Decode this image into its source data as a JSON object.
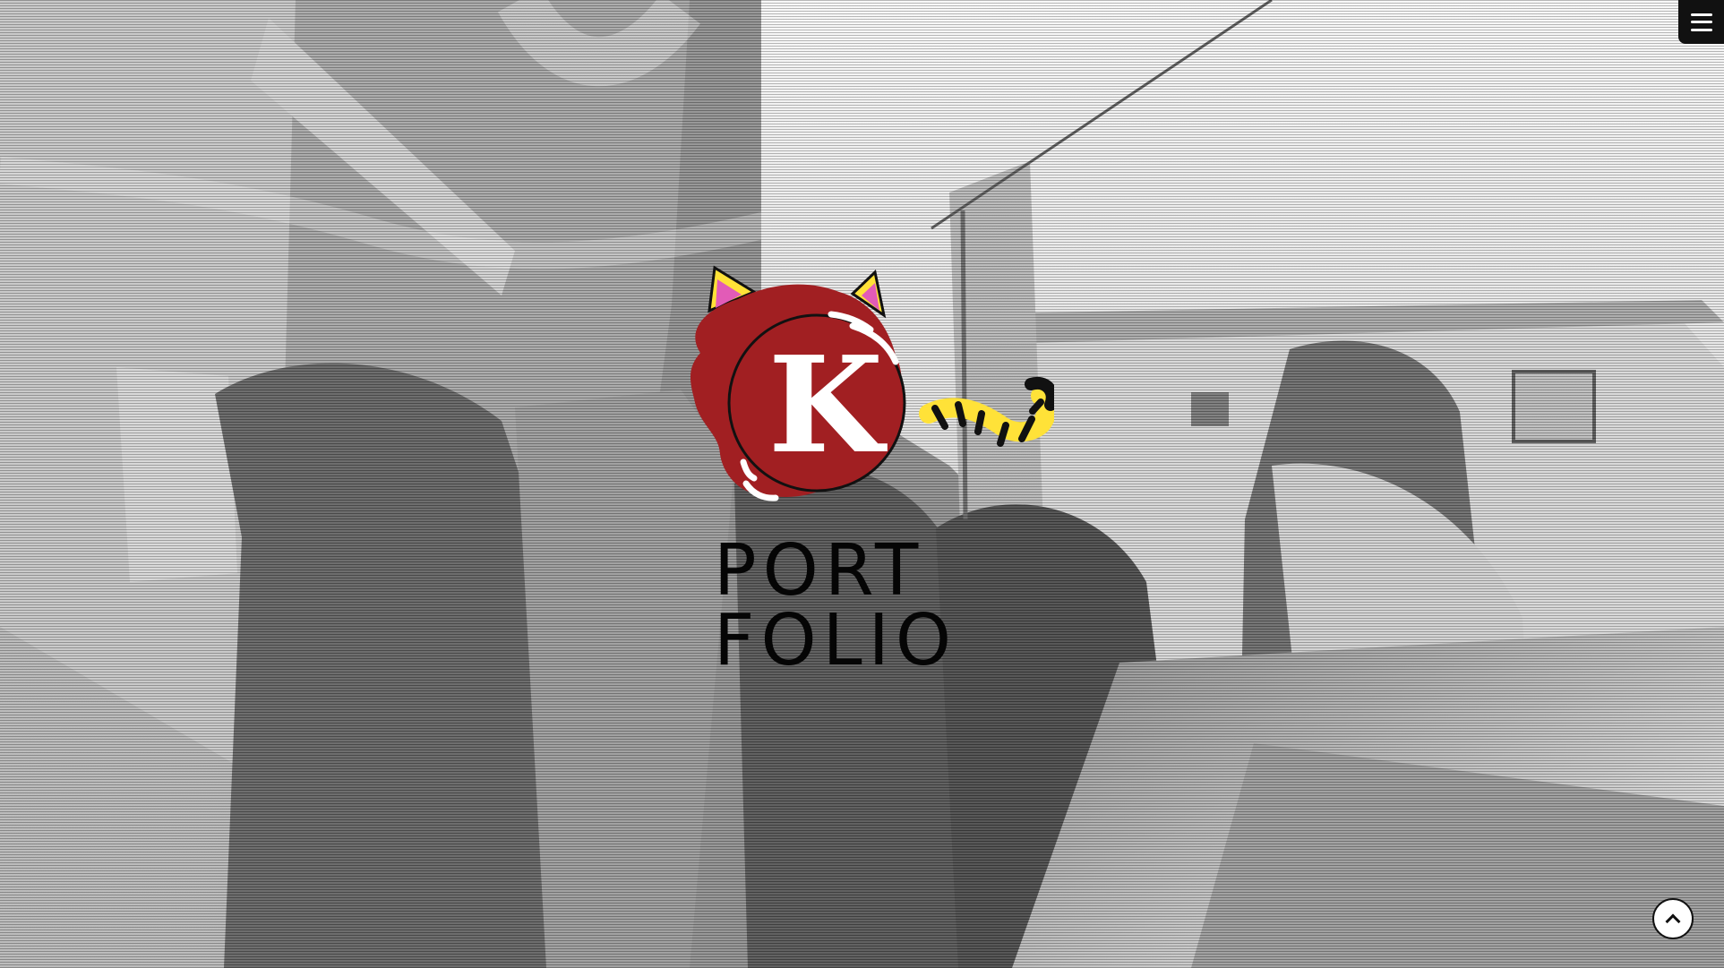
{
  "logo": {
    "letter": "K",
    "line1": "PORT",
    "line2": "FOLIO"
  },
  "icons": {
    "menu": "hamburger-menu-icon",
    "scroll_top": "chevron-up-icon",
    "logo": "cat-wax-seal-logo"
  },
  "colors": {
    "seal_red": "#a11f22",
    "cat_ear_yellow": "#ffe238",
    "cat_ear_pink": "#e25bb7",
    "tail_yellow": "#ffe238",
    "tail_black": "#111111",
    "text_black": "#050505"
  }
}
